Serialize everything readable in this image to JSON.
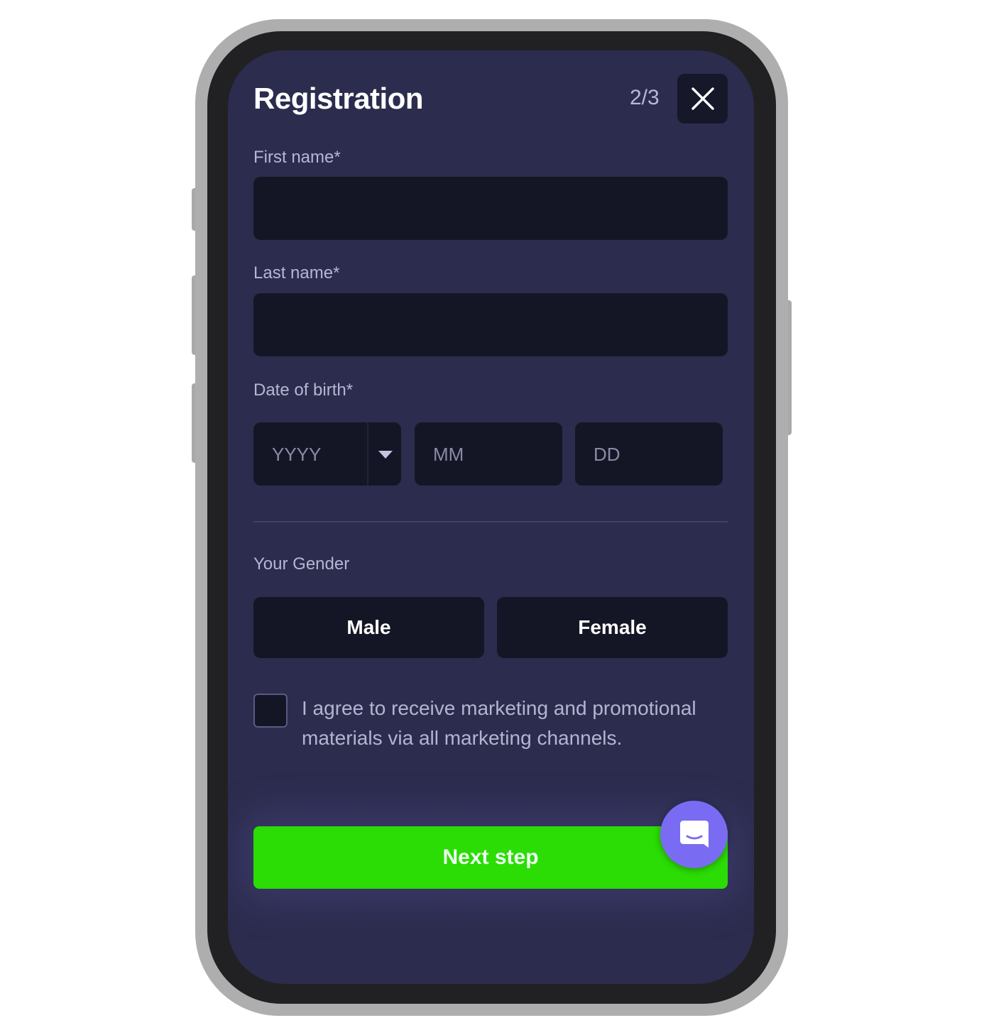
{
  "header": {
    "title": "Registration",
    "step": "2/3",
    "close_icon": "close-icon"
  },
  "form": {
    "first_name_label": "First name*",
    "first_name_value": "",
    "last_name_label": "Last name*",
    "last_name_value": "",
    "dob_label": "Date of birth*",
    "dob": {
      "year_placeholder": "YYYY",
      "month_placeholder": "MM",
      "day_placeholder": "DD",
      "year_icon": "chevron-down-icon"
    },
    "gender_label": "Your Gender",
    "gender_options": [
      "Male",
      "Female"
    ],
    "consent_checked": false,
    "consent_text": "I agree to receive marketing and promotional materials via all marketing channels.",
    "next_label": "Next step"
  },
  "chat": {
    "icon": "chat-icon"
  },
  "colors": {
    "screen_bg": "#2c2c4e",
    "field_bg": "#151625",
    "primary_button": "#2cdc05",
    "chat_button": "#7a6cf2"
  }
}
